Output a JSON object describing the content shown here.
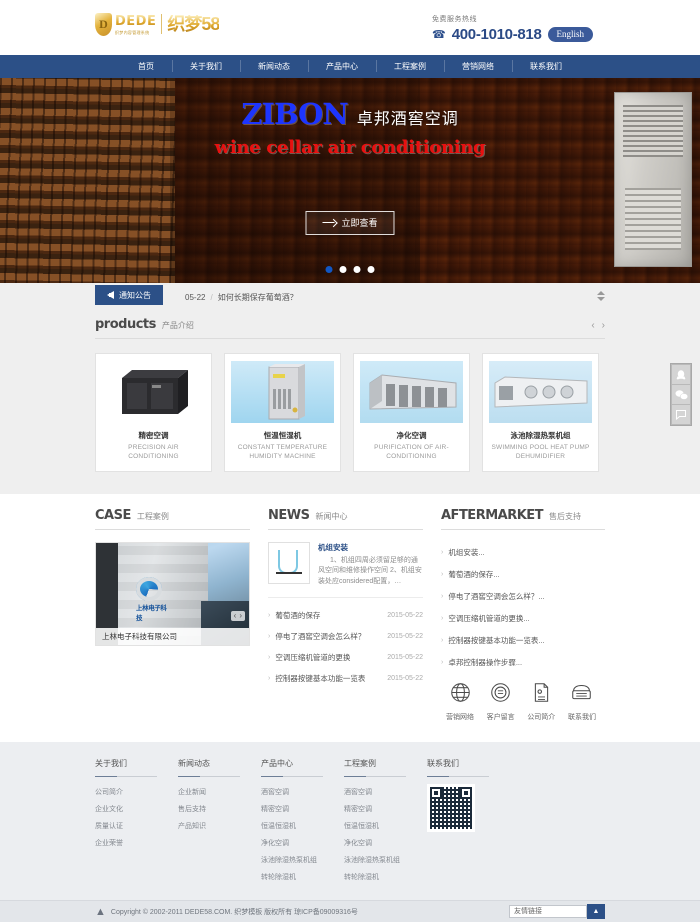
{
  "header": {
    "logo": {
      "badge": "D",
      "dede": "DEDE",
      "dede_sub": "织梦内容管理系统",
      "cn": "织梦58"
    },
    "hotline_label": "免费服务热线",
    "hotline_icon": "phone-icon",
    "hotline_number": "400-1010-818",
    "lang_button": "English"
  },
  "nav": {
    "items": [
      {
        "label": "首页"
      },
      {
        "label": "关于我们"
      },
      {
        "label": "新闻动态"
      },
      {
        "label": "产品中心"
      },
      {
        "label": "工程案例"
      },
      {
        "label": "营销网络"
      },
      {
        "label": "联系我们"
      }
    ]
  },
  "banner": {
    "brand": "ZIBON",
    "title_cn": "卓邦酒窖空调",
    "subtitle_en": "wine cellar air conditioning",
    "cta": "立即查看",
    "dots": 4,
    "active_dot": 0,
    "colors": {
      "brand": "#1d35ff",
      "subtitle": "#e81010",
      "dot_active": "#1157c4"
    }
  },
  "notice": {
    "tag": "通知公告",
    "date": "05-22",
    "separator": "/",
    "text": "如何长期保存葡萄酒？"
  },
  "products": {
    "title_en": "products",
    "title_cn": "产品介绍",
    "prev": "‹",
    "next": "›",
    "items": [
      {
        "name": "精密空调",
        "name_en": "PRECISION AIR CONDITIONING"
      },
      {
        "name": "恒温恒湿机",
        "name_en": "CONSTANT TEMPERATURE HUMIDITY MACHINE"
      },
      {
        "name": "净化空调",
        "name_en": "PURIFICATION OF AIR-CONDITIONING"
      },
      {
        "name": "泳池除湿热泵机组",
        "name_en": "SWIMMING POOL HEAT PUMP DEHUMIDIFIER"
      }
    ]
  },
  "case": {
    "title_en": "CASE",
    "title_cn": "工程案例",
    "photo_logo_text": "上林电子科技",
    "caption": "上林电子科技有限公司",
    "prev": "‹",
    "next": "›"
  },
  "news": {
    "title_en": "NEWS",
    "title_cn": "新闻中心",
    "featured": {
      "title": "机组安装",
      "desc": "1、机组四周必须留足够的通风空间和维修操作空间 2、机组安装处应considered配置，…"
    },
    "items": [
      {
        "title": "葡萄酒的保存",
        "date": "2015-05-22"
      },
      {
        "title": "停电了酒窖空调会怎么样？",
        "date": "2015-05-22"
      },
      {
        "title": "空调压缩机管道的更换",
        "date": "2015-05-22"
      },
      {
        "title": "控制器按键基本功能一览表",
        "date": "2015-05-22"
      }
    ]
  },
  "aftermarket": {
    "title_en": "AFTERMARKET",
    "title_cn": "售后支持",
    "items": [
      {
        "title": "机组安装..."
      },
      {
        "title": "葡萄酒的保存..."
      },
      {
        "title": "停电了酒窖空调会怎么样？..."
      },
      {
        "title": "空调压缩机管道的更换..."
      },
      {
        "title": "控制器按键基本功能一览表..."
      },
      {
        "title": "卓邦控制器操作步骤..."
      }
    ],
    "icons": [
      {
        "icon": "globe-icon",
        "glyph": "ἱ0",
        "label": "营销网络"
      },
      {
        "icon": "chat-bubbles-icon",
        "glyph": "◎",
        "label": "客户留言"
      },
      {
        "icon": "document-icon",
        "glyph": "Ὄ4",
        "label": "公司简介"
      },
      {
        "icon": "telephone-icon",
        "glyph": "☎",
        "label": "联系我们"
      }
    ]
  },
  "footer": {
    "columns": [
      {
        "heading": "关于我们",
        "links": [
          "公司简介",
          "企业文化",
          "质量认证",
          "企业荣誉"
        ]
      },
      {
        "heading": "新闻动态",
        "links": [
          "企业新闻",
          "售后支持",
          "产品知识"
        ]
      },
      {
        "heading": "产品中心",
        "links": [
          "酒窖空调",
          "精密空调",
          "恒温恒湿机",
          "净化空调",
          "泳池除湿热泵机组",
          "转轮除湿机"
        ]
      },
      {
        "heading": "工程案例",
        "links": [
          "酒窖空调",
          "精密空调",
          "恒温恒湿机",
          "净化空调",
          "泳池除湿热泵机组",
          "转轮除湿机"
        ]
      }
    ],
    "contact": {
      "heading": "联系我们",
      "qr_name": "qr-code"
    }
  },
  "copyright": {
    "icon": "site-mark-icon",
    "text": "Copyright © 2002-2011 DEDE58.COM. 织梦模板 版权所有 琼ICP备09009316号",
    "links_placeholder": "友情链接",
    "links_button": "▲"
  },
  "side_widget": {
    "buttons": [
      {
        "icon": "qq-penguin-icon",
        "glyph": "◓"
      },
      {
        "icon": "wechat-icon",
        "glyph": "✿"
      },
      {
        "icon": "message-icon",
        "glyph": "▧"
      }
    ]
  }
}
